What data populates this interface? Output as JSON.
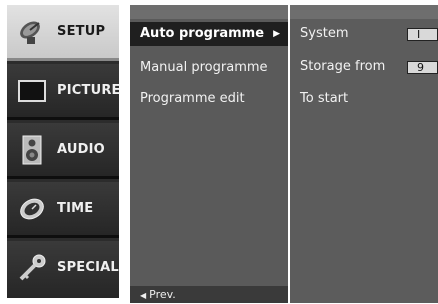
{
  "tabs": [
    {
      "label": "SETUP",
      "icon": "satellite-dish-icon",
      "active": true
    },
    {
      "label": "PICTURE",
      "icon": "screen-icon",
      "active": false
    },
    {
      "label": "AUDIO",
      "icon": "speaker-icon",
      "active": false
    },
    {
      "label": "TIME",
      "icon": "clock-icon",
      "active": false
    },
    {
      "label": "SPECIAL",
      "icon": "key-icon",
      "active": false
    }
  ],
  "menu": {
    "items": [
      {
        "label": "Auto programme",
        "arrow": "▶",
        "selected": true
      },
      {
        "label": "Manual programme",
        "selected": false
      },
      {
        "label": "Programme edit",
        "selected": false
      }
    ],
    "prev_label": "Prev.",
    "prev_arrow": "◀"
  },
  "detail": {
    "rows": [
      {
        "label": "System",
        "value": "I"
      },
      {
        "label": "Storage from",
        "value": "9"
      },
      {
        "label": "To start",
        "value": ""
      }
    ]
  }
}
